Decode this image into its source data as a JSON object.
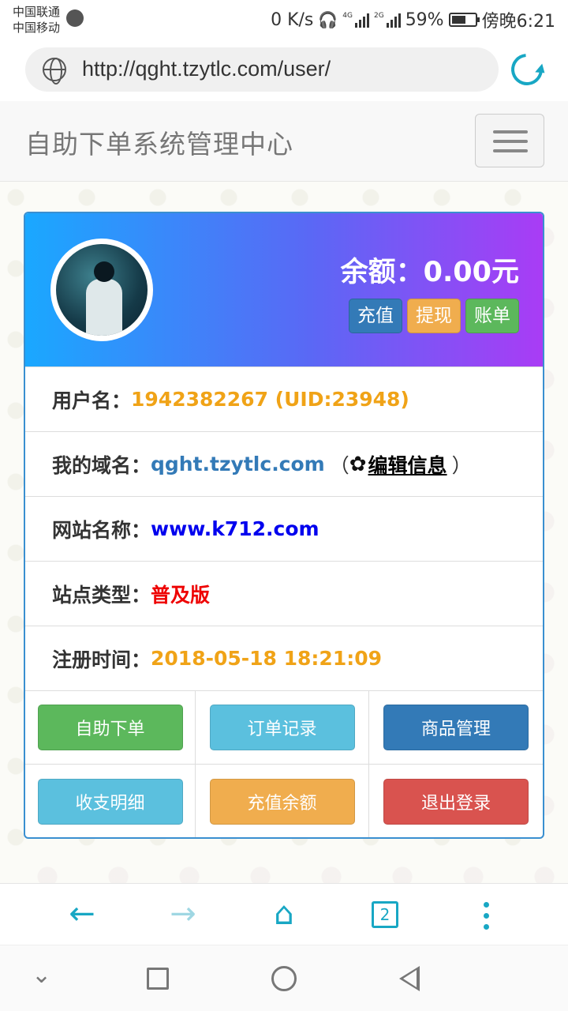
{
  "status_bar": {
    "carrier_1": "中国联通",
    "carrier_2": "中国移动",
    "speed": "0 K/s",
    "net_1": "4G",
    "net_2": "2G",
    "battery_percent": "59%",
    "time": "傍晚6:21"
  },
  "address_bar": {
    "url": "http://qght.tzytlc.com/user/"
  },
  "navbar": {
    "brand": "自助下单系统管理中心"
  },
  "panel": {
    "balance_text": "余额：0.00元",
    "head_buttons": [
      {
        "label": "充值",
        "color": "#337ab7"
      },
      {
        "label": "提现",
        "color": "#f0ad4e"
      },
      {
        "label": "账单",
        "color": "#5cb85c"
      }
    ],
    "rows": {
      "username": {
        "label": "用户名：",
        "value": "1942382267 (UID:23948)"
      },
      "domain": {
        "label": "我的域名：",
        "value": "qght.tzytlc.com",
        "paren_open": "（",
        "edit_label": "编辑信息",
        "paren_close": "）"
      },
      "site_name": {
        "label": "网站名称：",
        "value": "www.k712.com"
      },
      "site_type": {
        "label": "站点类型：",
        "value": "普及版"
      },
      "reg_time": {
        "label": "注册时间：",
        "value": "2018-05-18 18:21:09"
      }
    },
    "actions": [
      {
        "label": "自助下单",
        "color": "#5cb85c"
      },
      {
        "label": "订单记录",
        "color": "#5bc0de"
      },
      {
        "label": "商品管理",
        "color": "#337ab7"
      },
      {
        "label": "收支明细",
        "color": "#5bc0de"
      },
      {
        "label": "充值余额",
        "color": "#f0ad4e"
      },
      {
        "label": "退出登录",
        "color": "#d9534f"
      }
    ]
  },
  "browser_bar": {
    "tab_count": "2"
  },
  "colors": {
    "accent": "#18a7c4",
    "header_gradient_start": "#1aa8ff",
    "header_gradient_end": "#a93cf5"
  }
}
